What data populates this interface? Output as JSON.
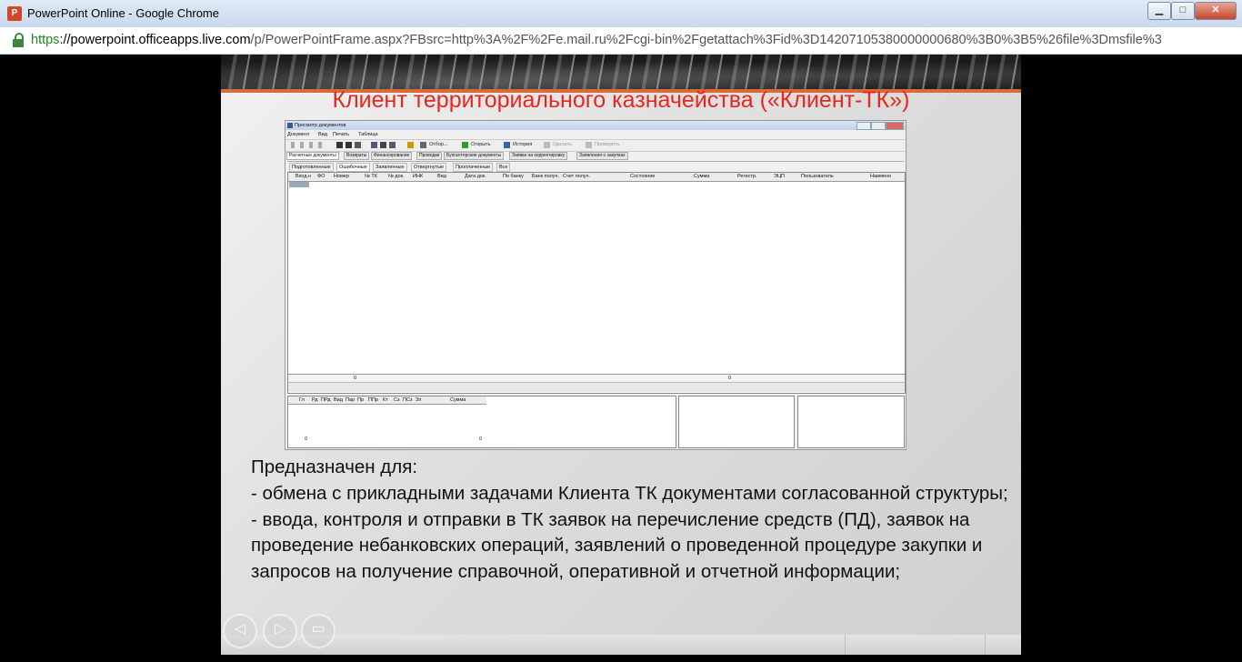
{
  "window": {
    "title": "PowerPoint Online - Google Chrome",
    "app_icon": "P",
    "controls": {
      "minimize": "▁",
      "maximize": "□",
      "close": "✕"
    }
  },
  "address": {
    "scheme": "https",
    "host": "://powerpoint.officeapps.live.com",
    "path": "/p/PowerPointFrame.aspx?FBsrc=http%3A%2F%2Fe.mail.ru%2Fcgi-bin%2Fgetattach%3Fid%3D14207105380000000680%3B0%3B5%26file%3Dmsfile%3",
    "scroll_arrow": "›"
  },
  "slide": {
    "title": "Клиент территориального казначейства («Клиент-ТК»)",
    "body": [
      "Предназначен для:",
      "- обмена с прикладными задачами Клиента ТК документами согласованной структуры;",
      "- ввода, контроля и отправки в ТК заявок на перечисление средств (ПД), заявок на проведение небанковских операций, заявлений о проведенной процедуре закупки и запросов на получение справочной, оперативной и отчетной информации;"
    ],
    "nav": {
      "prev": "◁",
      "next": "▷",
      "notes": "▭"
    }
  },
  "embedded_app": {
    "title": "Просмотр документов",
    "menu": [
      "Документ",
      "Вид",
      "Печать",
      "Таблица"
    ],
    "toolbar": [
      "Отбор...",
      "Открыть",
      "История",
      "Удалить",
      "Проверить"
    ],
    "tabs_top": [
      "Расчетные документы",
      "Возвраты",
      "Финансирование",
      "Проводки",
      "Бухгалтерские документы",
      "Заявки на корректировку",
      "Заявления о закупках"
    ],
    "tabs_sub": [
      "Подготовленные",
      "Ошибочные",
      "Заявленные",
      "Отвергнутые",
      "Проплаченные",
      "Все"
    ],
    "columns": [
      "Вход.н",
      "ФО",
      "Номер",
      "№ ТК",
      "№ док.",
      "ИНК",
      "Вид",
      "Дата док.",
      "По банку",
      "Банк получ.",
      "Счет получ.",
      "Состояние",
      "Сумма",
      "Регистр.",
      "ЭЦП",
      "Пользователь",
      "Наимено"
    ],
    "footer_values": [
      "0",
      "0"
    ],
    "bottom_columns": [
      "Гл",
      "Рд",
      "ПРд",
      "Вид",
      "Пар",
      "Пр",
      "ППр",
      "Кт",
      "Сз",
      "ПСз",
      "Зп",
      "Сумма"
    ],
    "bottom_footer_values": [
      "0",
      "0"
    ]
  }
}
